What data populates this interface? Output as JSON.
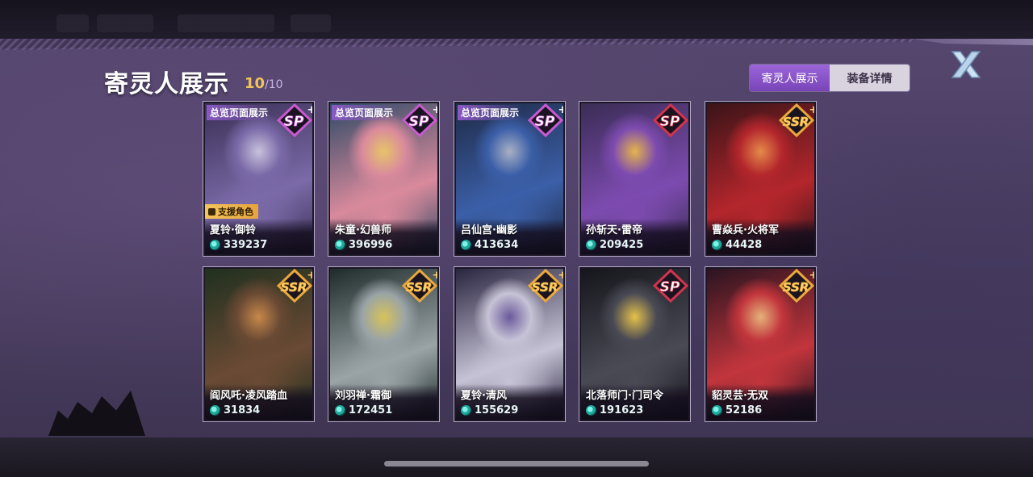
{
  "header": {
    "title": "寄灵人展示",
    "count_current": "10",
    "count_total": "/10"
  },
  "tabs": [
    {
      "label": "寄灵人展示",
      "active": true
    },
    {
      "label": "装备详情",
      "active": false
    }
  ],
  "close_icon": "close-x-icon",
  "colors": {
    "accent": "#8a55c8",
    "sp_badge": "#d2344e",
    "sp_plus_badge": "#c85ad0",
    "ssr_badge": "#e9a83b",
    "power": "#2cc2b4"
  },
  "cards": [
    {
      "overview_label": "总览页面展示",
      "support_label": "支援角色",
      "rarity": "SP+",
      "name": "夏铃·御铃",
      "power": "339237",
      "art_colors": [
        "#3a2f55",
        "#7b6aa8",
        "#c8c2dc"
      ]
    },
    {
      "overview_label": "总览页面展示",
      "support_label": "",
      "rarity": "SP+",
      "name": "朱童·幻兽师",
      "power": "396996",
      "art_colors": [
        "#2f4a66",
        "#d98a9c",
        "#e7c46a"
      ]
    },
    {
      "overview_label": "总览页面展示",
      "support_label": "",
      "rarity": "SP+",
      "name": "吕仙宫·幽影",
      "power": "413634",
      "art_colors": [
        "#1f2b47",
        "#3b5fa8",
        "#a9b0c4"
      ]
    },
    {
      "overview_label": "",
      "support_label": "",
      "rarity": "SP",
      "name": "孙斩天·雷帝",
      "power": "209425",
      "art_colors": [
        "#3a2d55",
        "#7d4bb0",
        "#e5b54a"
      ]
    },
    {
      "overview_label": "",
      "support_label": "",
      "rarity": "SSR+",
      "name": "曹焱兵·火将军",
      "power": "44428",
      "art_colors": [
        "#3a1418",
        "#b3262c",
        "#e58a4a"
      ]
    },
    {
      "overview_label": "",
      "support_label": "",
      "rarity": "SSR+",
      "name": "阎风吒·凌风踏血",
      "power": "31834",
      "art_colors": [
        "#20301f",
        "#6a4a34",
        "#c7884b"
      ]
    },
    {
      "overview_label": "",
      "support_label": "",
      "rarity": "SSR+",
      "name": "刘羽禅·霜御",
      "power": "172451",
      "art_colors": [
        "#1f2a2a",
        "#9aa4a6",
        "#d6c25a"
      ]
    },
    {
      "overview_label": "",
      "support_label": "",
      "rarity": "SSR+",
      "name": "夏铃·清风",
      "power": "155629",
      "art_colors": [
        "#2a2540",
        "#c7c3d6",
        "#6a5a9a"
      ]
    },
    {
      "overview_label": "",
      "support_label": "",
      "rarity": "SP",
      "name": "北落师门·门司令",
      "power": "191623",
      "art_colors": [
        "#15151b",
        "#4a4a55",
        "#e5c24a"
      ]
    },
    {
      "overview_label": "",
      "support_label": "",
      "rarity": "SSR+",
      "name": "貂灵芸·无双",
      "power": "52186",
      "art_colors": [
        "#2a1420",
        "#c2353c",
        "#e5b27a"
      ]
    }
  ]
}
